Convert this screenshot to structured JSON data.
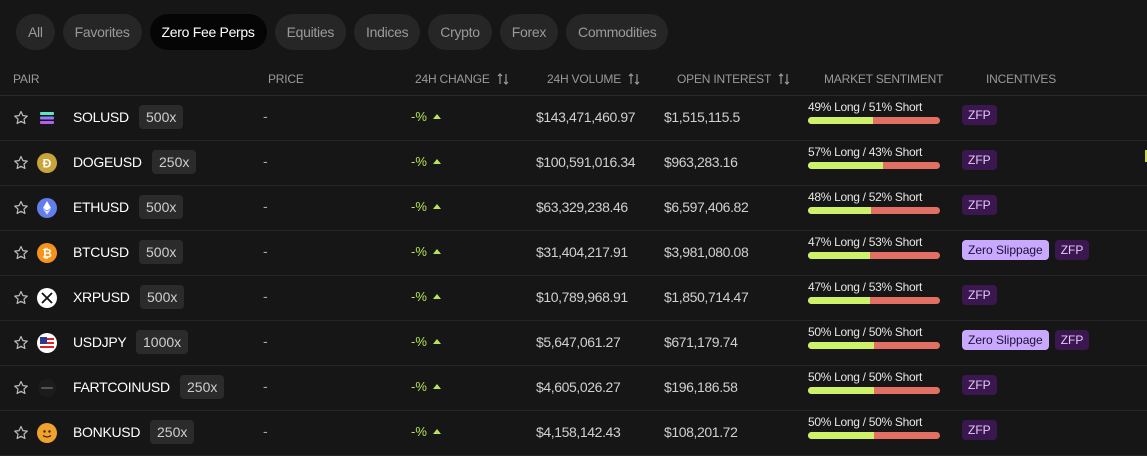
{
  "tabs": [
    {
      "label": "All",
      "active": false
    },
    {
      "label": "Favorites",
      "active": false
    },
    {
      "label": "Zero Fee Perps",
      "active": true
    },
    {
      "label": "Equities",
      "active": false
    },
    {
      "label": "Indices",
      "active": false
    },
    {
      "label": "Crypto",
      "active": false
    },
    {
      "label": "Forex",
      "active": false
    },
    {
      "label": "Commodities",
      "active": false
    }
  ],
  "columns": {
    "pair": "PAIR",
    "price": "PRICE",
    "change": "24H CHANGE",
    "volume": "24H VOLUME",
    "open_interest": "OPEN INTEREST",
    "sentiment": "MARKET SENTIMENT",
    "incentives": "INCENTIVES"
  },
  "rows": [
    {
      "symbol": "SOLUSD",
      "leverage": "500x",
      "icon": "solana-icon",
      "price": "-",
      "change": "-%",
      "volume": "$143,471,460.97",
      "open_interest": "$1,515,115.5",
      "sentiment": "49% Long / 51% Short",
      "long_pct": 49,
      "incentives": [
        "ZFP"
      ]
    },
    {
      "symbol": "DOGEUSD",
      "leverage": "250x",
      "icon": "dogecoin-icon",
      "price": "-",
      "change": "-%",
      "volume": "$100,591,016.34",
      "open_interest": "$963,283.16",
      "sentiment": "57% Long / 43% Short",
      "long_pct": 57,
      "incentives": [
        "ZFP"
      ]
    },
    {
      "symbol": "ETHUSD",
      "leverage": "500x",
      "icon": "ethereum-icon",
      "price": "-",
      "change": "-%",
      "volume": "$63,329,238.46",
      "open_interest": "$6,597,406.82",
      "sentiment": "48% Long / 52% Short",
      "long_pct": 48,
      "incentives": [
        "ZFP"
      ]
    },
    {
      "symbol": "BTCUSD",
      "leverage": "500x",
      "icon": "bitcoin-icon",
      "price": "-",
      "change": "-%",
      "volume": "$31,404,217.91",
      "open_interest": "$3,981,080.08",
      "sentiment": "47% Long / 53% Short",
      "long_pct": 47,
      "incentives": [
        "Zero Slippage",
        "ZFP"
      ]
    },
    {
      "symbol": "XRPUSD",
      "leverage": "500x",
      "icon": "xrp-icon",
      "price": "-",
      "change": "-%",
      "volume": "$10,789,968.91",
      "open_interest": "$1,850,714.47",
      "sentiment": "47% Long / 53% Short",
      "long_pct": 47,
      "incentives": [
        "ZFP"
      ]
    },
    {
      "symbol": "USDJPY",
      "leverage": "1000x",
      "icon": "us-flag-icon",
      "price": "-",
      "change": "-%",
      "volume": "$5,647,061.27",
      "open_interest": "$671,179.74",
      "sentiment": "50% Long / 50% Short",
      "long_pct": 50,
      "incentives": [
        "Zero Slippage",
        "ZFP"
      ]
    },
    {
      "symbol": "FARTCOINUSD",
      "leverage": "250x",
      "icon": "fartcoin-icon",
      "price": "-",
      "change": "-%",
      "volume": "$4,605,026.27",
      "open_interest": "$196,186.58",
      "sentiment": "50% Long / 50% Short",
      "long_pct": 50,
      "incentives": [
        "ZFP"
      ]
    },
    {
      "symbol": "BONKUSD",
      "leverage": "250x",
      "icon": "bonk-icon",
      "price": "-",
      "change": "-%",
      "volume": "$4,158,142.43",
      "open_interest": "$108,201.72",
      "sentiment": "50% Long / 50% Short",
      "long_pct": 50,
      "incentives": [
        "ZFP"
      ]
    }
  ],
  "colors": {
    "long": "#cdf26a",
    "short": "#e26f63",
    "positive": "#b6e35a",
    "zfp_badge": "#3b1750",
    "zero_slippage_badge": "#c8a9ff"
  }
}
